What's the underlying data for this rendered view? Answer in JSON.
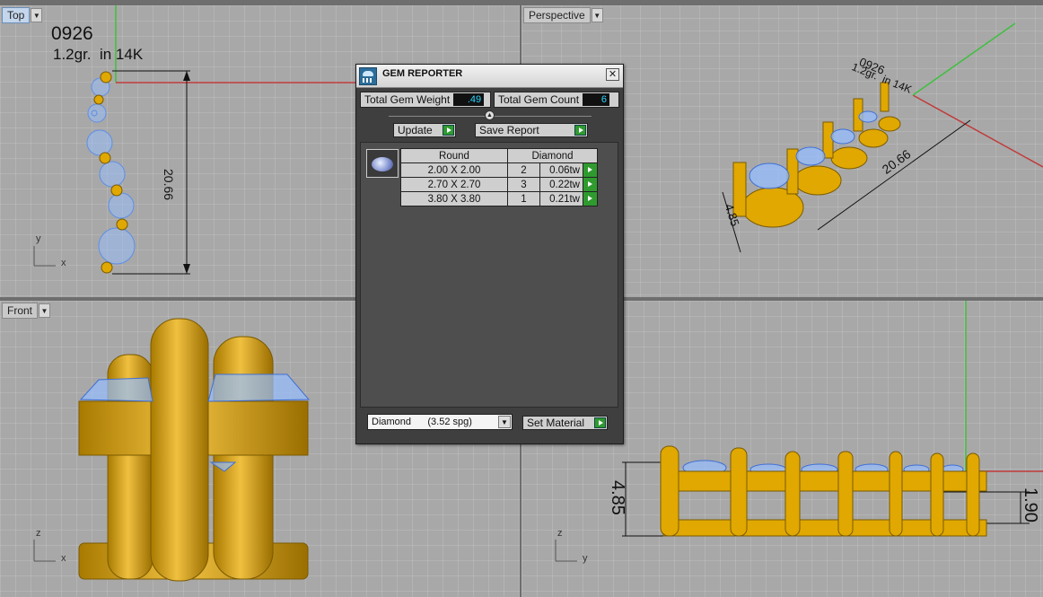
{
  "viewports": {
    "top": {
      "name": "Top",
      "annotation_line1": "0926",
      "annotation_line2": "1.2gr.  in 14K",
      "dimension": "20.66",
      "axis_y": "y",
      "axis_x": "x"
    },
    "perspective": {
      "name": "Perspective",
      "annotation_line1": "0926",
      "annotation_line2": "1.2gr.  in 14K",
      "dimension_long": "20.66",
      "dimension_height": "4.85"
    },
    "front": {
      "name": "Front",
      "axis_z": "z",
      "axis_x": "x"
    },
    "right": {
      "dimension_height": "4.85",
      "dimension_inner": "1.90",
      "axis_z": "z",
      "axis_y": "y"
    }
  },
  "gem_reporter": {
    "title": "GEM REPORTER",
    "close_label": "✕",
    "total_weight_label": "Total Gem Weight",
    "total_weight_value": ".49",
    "total_count_label": "Total Gem Count",
    "total_count_value": "6",
    "update_label": "Update",
    "save_report_label": "Save Report",
    "table": {
      "shape_header": "Round",
      "material_header": "Diamond",
      "rows": [
        {
          "size": "2.00 X 2.00",
          "count": "2",
          "weight": "0.06tw"
        },
        {
          "size": "2.70 X 2.70",
          "count": "3",
          "weight": "0.22tw"
        },
        {
          "size": "3.80 X 3.80",
          "count": "1",
          "weight": "0.21tw"
        }
      ]
    },
    "material_select": "Diamond      (3.52 spg)",
    "set_material_label": "Set Material"
  },
  "colors": {
    "gold": "#e0a800",
    "gem": "#8fb6ff",
    "axis_green": "#3fbf3f",
    "axis_red": "#c03a3a",
    "panel": "#3f3f3f"
  }
}
